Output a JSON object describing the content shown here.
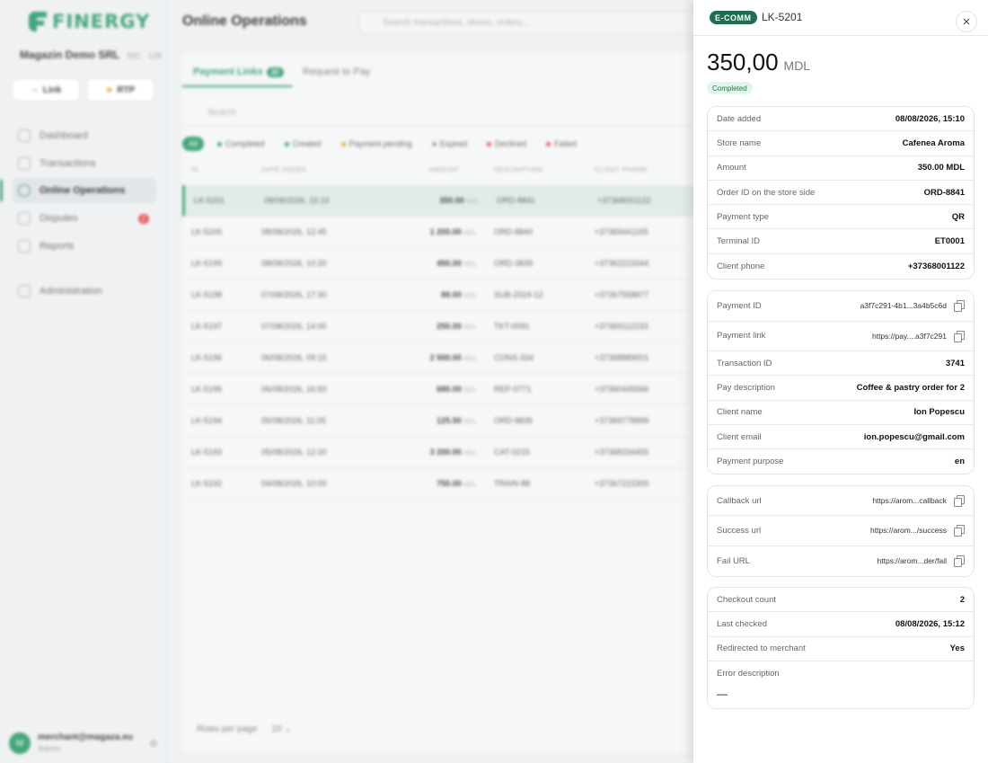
{
  "sidebar": {
    "brand": "FINERGY",
    "company": "Magazin Demo SRL",
    "company_meta": "IDC · 128",
    "quick_actions": [
      "Link",
      "RTP"
    ],
    "nav": [
      {
        "label": "Dashboard"
      },
      {
        "label": "Transactions"
      },
      {
        "label": "Online Operations"
      },
      {
        "label": "Disputes",
        "badge": "2"
      },
      {
        "label": "Reports"
      },
      {
        "label": "Administration"
      }
    ],
    "user_email": "merchant@magaza.eu",
    "user_role": "Admin",
    "user_initial": "M"
  },
  "main": {
    "title": "Online Operations",
    "search_placeholder": "Search transactions, stores, orders...",
    "tabs": [
      {
        "label": "Payment Links",
        "count": "20"
      },
      {
        "label": "Request to Pay"
      }
    ],
    "list_search_placeholder": "Search",
    "filters": [
      {
        "label": "All",
        "color": ""
      },
      {
        "label": "Completed",
        "color": "#2c9a6a"
      },
      {
        "label": "Created",
        "color": "#2c9a6a"
      },
      {
        "label": "Payment pending",
        "color": "#e0a020"
      },
      {
        "label": "Expired",
        "color": "#999999"
      },
      {
        "label": "Declined",
        "color": "#e04848"
      },
      {
        "label": "Failed",
        "color": "#e04848"
      }
    ],
    "columns": [
      "ID",
      "DATE ADDED",
      "AMOUNT",
      "DESCRIPTION",
      "CLIENT PHONE"
    ],
    "rows": [
      {
        "id": "LK-5201",
        "date": "08/08/2026, 15:10",
        "amount": "350.00",
        "cur": "MDL",
        "desc": "ORD-8841",
        "phone": "+37368001122"
      },
      {
        "id": "LK-5200",
        "date": "08/08/2026, 12:45",
        "amount": "1 200.00",
        "cur": "MDL",
        "desc": "ORD-8840",
        "phone": "+37369441165"
      },
      {
        "id": "LK-5199",
        "date": "08/08/2026, 10:20",
        "amount": "450.00",
        "cur": "MDL",
        "desc": "ORD-3839",
        "phone": "+37362223344"
      },
      {
        "id": "LK-5198",
        "date": "07/08/2026, 17:30",
        "amount": "89.00",
        "cur": "MDL",
        "desc": "SUB-2024-12",
        "phone": "+37367558877"
      },
      {
        "id": "LK-5197",
        "date": "07/08/2026, 14:00",
        "amount": "250.00",
        "cur": "MDL",
        "desc": "TKT-0091",
        "phone": "+37369112233"
      },
      {
        "id": "LK-5196",
        "date": "06/08/2026, 09:15",
        "amount": "2 500.00",
        "cur": "MDL",
        "desc": "CONS-334",
        "phone": "+37368889001"
      },
      {
        "id": "LK-5195",
        "date": "06/08/2026, 16:50",
        "amount": "680.00",
        "cur": "MDL",
        "desc": "REP-0771",
        "phone": "+37360445566"
      },
      {
        "id": "LK-5194",
        "date": "05/08/2026, 11:05",
        "amount": "125.50",
        "cur": "MDL",
        "desc": "ORD-8835",
        "phone": "+37369778899"
      },
      {
        "id": "LK-5193",
        "date": "05/08/2026, 12:20",
        "amount": "3 200.00",
        "cur": "MDL",
        "desc": "CAT-0215",
        "phone": "+37368334455"
      },
      {
        "id": "LK-5192",
        "date": "04/08/2026, 10:00",
        "amount": "750.00",
        "cur": "MDL",
        "desc": "TRAIN-88",
        "phone": "+37367223300"
      }
    ],
    "rows_per_page_label": "Rows per page",
    "rows_per_page": "10"
  },
  "drawer": {
    "tag": "E-COMM",
    "id": "LK-5201",
    "amount": "350,00",
    "currency": "MDL",
    "status": "Completed",
    "summary": [
      {
        "label": "Date added",
        "value": "08/08/2026, 15:10"
      },
      {
        "label": "Store name",
        "value": "Cafenea Aroma"
      },
      {
        "label": "Amount",
        "value": "350.00 MDL"
      },
      {
        "label": "Order ID on the store side",
        "value": "ORD-8841"
      },
      {
        "label": "Payment type",
        "value": "QR"
      },
      {
        "label": "Terminal ID",
        "value": "ET0001"
      },
      {
        "label": "Client phone",
        "value": "+37368001122"
      }
    ],
    "payment": [
      {
        "label": "Payment ID",
        "value": "a3f7c291-4b1...3a4b5c6d",
        "copy": true
      },
      {
        "label": "Payment link",
        "value": "https://pay....a3f7c291",
        "copy": true
      },
      {
        "label": "Transaction ID",
        "value": "3741"
      },
      {
        "label": "Pay description",
        "value": "Coffee & pastry order for 2"
      },
      {
        "label": "Client name",
        "value": "Ion Popescu"
      },
      {
        "label": "Client email",
        "value": "ion.popescu@gmail.com"
      },
      {
        "label": "Payment purpose",
        "value": "en"
      }
    ],
    "urls": [
      {
        "label": "Callback url",
        "value": "https://arom...callback"
      },
      {
        "label": "Success url",
        "value": "https://arom.../success"
      },
      {
        "label": "Fail URL",
        "value": "https://arom...der/fail"
      }
    ],
    "checkout": [
      {
        "label": "Checkout count",
        "value": "2"
      },
      {
        "label": "Last checked",
        "value": "08/08/2026, 15:12"
      },
      {
        "label": "Redirected to merchant",
        "value": "Yes"
      }
    ],
    "error_label": "Error description",
    "error_value": "—"
  }
}
